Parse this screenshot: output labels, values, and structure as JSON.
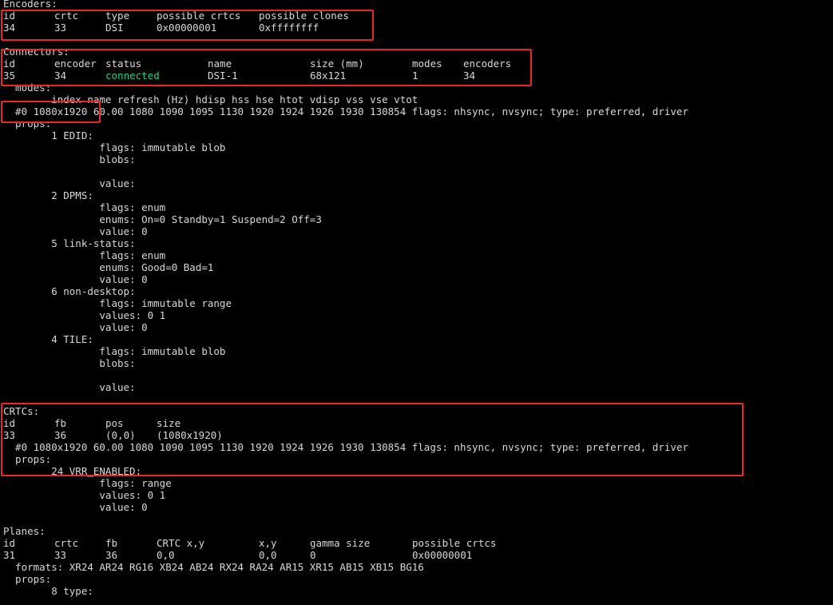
{
  "terminal": {
    "lines": [
      {
        "name": "encoders-header",
        "segs": [
          {
            "c": 0,
            "t": "Encoders:"
          }
        ]
      },
      {
        "name": "encoders-columns",
        "segs": [
          {
            "c": 0,
            "t": "id"
          },
          {
            "c": 8,
            "t": "crtc"
          },
          {
            "c": 16,
            "t": "type"
          },
          {
            "c": 24,
            "t": "possible crtcs"
          },
          {
            "c": 40,
            "t": "possible clones"
          }
        ]
      },
      {
        "name": "encoders-row",
        "segs": [
          {
            "c": 0,
            "t": "34"
          },
          {
            "c": 8,
            "t": "33"
          },
          {
            "c": 16,
            "t": "DSI"
          },
          {
            "c": 24,
            "t": "0x00000001"
          },
          {
            "c": 40,
            "t": "0xffffffff"
          }
        ]
      },
      {
        "name": "blank-line",
        "segs": []
      },
      {
        "name": "connectors-header",
        "segs": [
          {
            "c": 0,
            "t": "Connectors:"
          }
        ]
      },
      {
        "name": "connectors-columns",
        "segs": [
          {
            "c": 0,
            "t": "id"
          },
          {
            "c": 8,
            "t": "encoder"
          },
          {
            "c": 16,
            "t": "status"
          },
          {
            "c": 32,
            "t": "name"
          },
          {
            "c": 48,
            "t": "size (mm)"
          },
          {
            "c": 64,
            "t": "modes"
          },
          {
            "c": 72,
            "t": "encoders"
          }
        ]
      },
      {
        "name": "connectors-row",
        "segs": [
          {
            "c": 0,
            "t": "35"
          },
          {
            "c": 8,
            "t": "34"
          },
          {
            "c": 16,
            "t": "connected",
            "cls": "green"
          },
          {
            "c": 32,
            "t": "DSI-1"
          },
          {
            "c": 48,
            "t": "68x121"
          },
          {
            "c": 64,
            "t": "1"
          },
          {
            "c": 72,
            "t": "34"
          }
        ]
      },
      {
        "name": "connector-modes-label",
        "segs": [
          {
            "c": 0,
            "t": "  modes:"
          }
        ]
      },
      {
        "name": "connector-modes-columns",
        "segs": [
          {
            "c": 0,
            "t": "        index name refresh (Hz) hdisp hss hse htot vdisp vss vse vtot"
          }
        ]
      },
      {
        "name": "connector-mode-0",
        "segs": [
          {
            "c": 0,
            "t": "  #0 1080x1920 60.00 1080 1090 1095 1130 1920 1924 1926 1930 130854 flags: nhsync, nvsync; type: preferred, driver"
          }
        ]
      },
      {
        "name": "connector-props-label",
        "segs": [
          {
            "c": 0,
            "t": "  props:"
          }
        ]
      },
      {
        "name": "prop-edid",
        "segs": [
          {
            "c": 0,
            "t": "        1 EDID:"
          }
        ]
      },
      {
        "name": "prop-edid-flags",
        "segs": [
          {
            "c": 0,
            "t": "                flags: immutable blob"
          }
        ]
      },
      {
        "name": "prop-edid-blobs",
        "segs": [
          {
            "c": 0,
            "t": "                blobs:"
          }
        ]
      },
      {
        "name": "blank-line",
        "segs": []
      },
      {
        "name": "prop-edid-value",
        "segs": [
          {
            "c": 0,
            "t": "                value:"
          }
        ]
      },
      {
        "name": "prop-dpms",
        "segs": [
          {
            "c": 0,
            "t": "        2 DPMS:"
          }
        ]
      },
      {
        "name": "prop-dpms-flags",
        "segs": [
          {
            "c": 0,
            "t": "                flags: enum"
          }
        ]
      },
      {
        "name": "prop-dpms-enums",
        "segs": [
          {
            "c": 0,
            "t": "                enums: On=0 Standby=1 Suspend=2 Off=3"
          }
        ]
      },
      {
        "name": "prop-dpms-value",
        "segs": [
          {
            "c": 0,
            "t": "                value: 0"
          }
        ]
      },
      {
        "name": "prop-link-status",
        "segs": [
          {
            "c": 0,
            "t": "        5 link-status:"
          }
        ]
      },
      {
        "name": "prop-link-status-flags",
        "segs": [
          {
            "c": 0,
            "t": "                flags: enum"
          }
        ]
      },
      {
        "name": "prop-link-status-enums",
        "segs": [
          {
            "c": 0,
            "t": "                enums: Good=0 Bad=1"
          }
        ]
      },
      {
        "name": "prop-link-status-value",
        "segs": [
          {
            "c": 0,
            "t": "                value: 0"
          }
        ]
      },
      {
        "name": "prop-non-desktop",
        "segs": [
          {
            "c": 0,
            "t": "        6 non-desktop:"
          }
        ]
      },
      {
        "name": "prop-non-desktop-flags",
        "segs": [
          {
            "c": 0,
            "t": "                flags: immutable range"
          }
        ]
      },
      {
        "name": "prop-non-desktop-values",
        "segs": [
          {
            "c": 0,
            "t": "                values: 0 1"
          }
        ]
      },
      {
        "name": "prop-non-desktop-value",
        "segs": [
          {
            "c": 0,
            "t": "                value: 0"
          }
        ]
      },
      {
        "name": "prop-tile",
        "segs": [
          {
            "c": 0,
            "t": "        4 TILE:"
          }
        ]
      },
      {
        "name": "prop-tile-flags",
        "segs": [
          {
            "c": 0,
            "t": "                flags: immutable blob"
          }
        ]
      },
      {
        "name": "prop-tile-blobs",
        "segs": [
          {
            "c": 0,
            "t": "                blobs:"
          }
        ]
      },
      {
        "name": "blank-line",
        "segs": []
      },
      {
        "name": "prop-tile-value",
        "segs": [
          {
            "c": 0,
            "t": "                value:"
          }
        ]
      },
      {
        "name": "blank-line",
        "segs": []
      },
      {
        "name": "crtcs-header",
        "segs": [
          {
            "c": 0,
            "t": "CRTCs:"
          }
        ]
      },
      {
        "name": "crtcs-columns",
        "segs": [
          {
            "c": 0,
            "t": "id"
          },
          {
            "c": 8,
            "t": "fb"
          },
          {
            "c": 16,
            "t": "pos"
          },
          {
            "c": 24,
            "t": "size"
          }
        ]
      },
      {
        "name": "crtcs-row",
        "segs": [
          {
            "c": 0,
            "t": "33"
          },
          {
            "c": 8,
            "t": "36"
          },
          {
            "c": 16,
            "t": "(0,0)"
          },
          {
            "c": 24,
            "t": "(1080x1920)"
          }
        ]
      },
      {
        "name": "crtc-mode-0",
        "segs": [
          {
            "c": 0,
            "t": "  #0 1080x1920 60.00 1080 1090 1095 1130 1920 1924 1926 1930 130854 flags: nhsync, nvsync; type: preferred, driver"
          }
        ]
      },
      {
        "name": "crtc-props-label",
        "segs": [
          {
            "c": 0,
            "t": "  props:"
          }
        ]
      },
      {
        "name": "prop-vrr-enabled",
        "segs": [
          {
            "c": 0,
            "t": "        24 VRR_ENABLED:"
          }
        ]
      },
      {
        "name": "prop-vrr-flags",
        "segs": [
          {
            "c": 0,
            "t": "                flags: range"
          }
        ]
      },
      {
        "name": "prop-vrr-values",
        "segs": [
          {
            "c": 0,
            "t": "                values: 0 1"
          }
        ]
      },
      {
        "name": "prop-vrr-value",
        "segs": [
          {
            "c": 0,
            "t": "                value: 0"
          }
        ]
      },
      {
        "name": "blank-line",
        "segs": []
      },
      {
        "name": "planes-header",
        "segs": [
          {
            "c": 0,
            "t": "Planes:"
          }
        ]
      },
      {
        "name": "planes-columns",
        "segs": [
          {
            "c": 0,
            "t": "id"
          },
          {
            "c": 8,
            "t": "crtc"
          },
          {
            "c": 16,
            "t": "fb"
          },
          {
            "c": 24,
            "t": "CRTC x,y"
          },
          {
            "c": 40,
            "t": "x,y"
          },
          {
            "c": 48,
            "t": "gamma size"
          },
          {
            "c": 64,
            "t": "possible crtcs"
          }
        ]
      },
      {
        "name": "planes-row",
        "segs": [
          {
            "c": 0,
            "t": "31"
          },
          {
            "c": 8,
            "t": "33"
          },
          {
            "c": 16,
            "t": "36"
          },
          {
            "c": 24,
            "t": "0,0"
          },
          {
            "c": 40,
            "t": "0,0"
          },
          {
            "c": 48,
            "t": "0"
          },
          {
            "c": 64,
            "t": "0x00000001"
          }
        ]
      },
      {
        "name": "plane-formats",
        "segs": [
          {
            "c": 0,
            "t": "  formats: XR24 AR24 RG16 XB24 AB24 RX24 RA24 AR15 XR15 AB15 XB15 BG16"
          }
        ]
      },
      {
        "name": "plane-props-label",
        "segs": [
          {
            "c": 0,
            "t": "  props:"
          }
        ]
      },
      {
        "name": "prop-type",
        "segs": [
          {
            "c": 0,
            "t": "        8 type:"
          }
        ]
      }
    ]
  },
  "colors": {
    "background": "#000000",
    "text": "#d8d8d8",
    "connected": "#23d18b",
    "highlight": "#e8262b"
  }
}
